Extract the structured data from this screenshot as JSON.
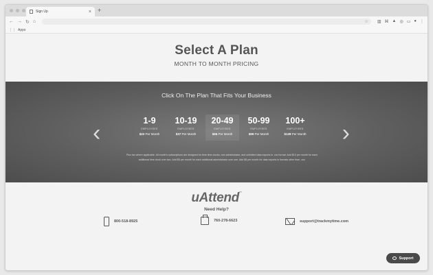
{
  "browser": {
    "tab_title": "Sign Up",
    "tab_close": "×",
    "new_tab": "+",
    "nav": {
      "back": "←",
      "forward": "→",
      "reload": "↻",
      "home": "⌂"
    },
    "omnibox_star": "☆",
    "bookmarks_label": "Apps"
  },
  "hero": {
    "title": "Select A Plan",
    "subtitle": "MONTH TO MONTH PRICING"
  },
  "plans_band": {
    "prompt": "Click On The Plan That Fits Your Business",
    "prev": "‹",
    "next": "›",
    "plans": [
      {
        "range": "1-9",
        "employees": "EMPLOYEES",
        "price": "$22",
        "per": " Per Month"
      },
      {
        "range": "10-19",
        "employees": "EMPLOYEES",
        "price": "$37",
        "per": " Per Month"
      },
      {
        "range": "20-49",
        "employees": "EMPLOYEES",
        "price": "$65",
        "per": " Per Month"
      },
      {
        "range": "50-99",
        "employees": "EMPLOYEES",
        "price": "$99",
        "per": " Per Month"
      },
      {
        "range": "100+",
        "employees": "EMPLOYEES",
        "price": "$139",
        "per": " Per Month"
      }
    ],
    "fine_print": "Plus tax where applicable. All month's subscriptions are designed for time time clocks, one administrator, and unlimited data exports in .csv format. Add $10 per month for each additional time clock over two. Add $5 per month for each additional administrator over one. Add $5 per month for data exports in formats other than .csv."
  },
  "footer": {
    "logo": "uAttend",
    "logo_mark": "™",
    "help": "Need Help?",
    "phone": "800-518-8925",
    "fax": "760-278-6623",
    "email": "support@trackmytime.com"
  },
  "support_button": "Support"
}
